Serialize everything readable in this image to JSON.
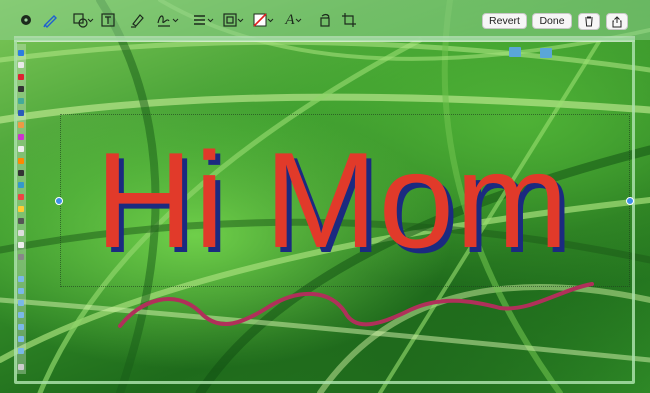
{
  "toolbar": {
    "tools": [
      {
        "name": "sketch-tool",
        "icon": "circle-dot-icon"
      },
      {
        "name": "draw-tool",
        "icon": "pen-icon"
      },
      {
        "name": "shapes-tool",
        "icon": "shapes-icon"
      },
      {
        "name": "text-tool",
        "icon": "text-box-icon"
      },
      {
        "name": "highlight-tool",
        "icon": "marker-icon"
      },
      {
        "name": "signature-tool",
        "icon": "signature-icon"
      },
      {
        "name": "line-style-tool",
        "icon": "lines-icon"
      },
      {
        "name": "border-color-tool",
        "icon": "border-icon"
      },
      {
        "name": "fill-color-tool",
        "icon": "fill-slash-icon"
      },
      {
        "name": "text-style-tool",
        "icon": "font-a-icon"
      },
      {
        "name": "rotate-tool",
        "icon": "rotate-icon"
      },
      {
        "name": "crop-tool",
        "icon": "crop-icon"
      }
    ],
    "revert_label": "Revert",
    "done_label": "Done",
    "font_glyph": "A"
  },
  "annotation": {
    "text": "Hi Mom",
    "text_color": "#e13a2a",
    "shadow_color": "#1b2a80",
    "signature_color": "#b0305a"
  },
  "handle_color": "#3e8ee8"
}
